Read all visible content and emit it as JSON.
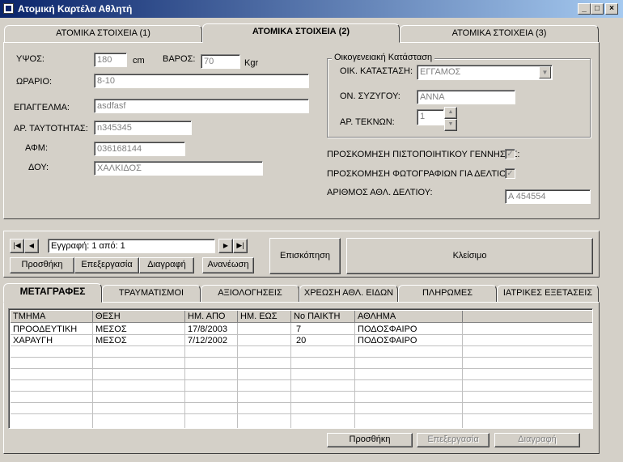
{
  "window": {
    "title": "Ατομική Καρτέλα Αθλητή"
  },
  "top_tabs": [
    "ΑΤΟΜΙΚΑ ΣΤΟΙΧΕΙΑ (1)",
    "ΑΤΟΜΙΚΑ ΣΤΟΙΧΕΙΑ (2)",
    "ΑΤΟΜΙΚΑ ΣΤΟΙΧΕΙΑ (3)"
  ],
  "form": {
    "height_label": "ΥΨΟΣ:",
    "height_value": "180",
    "height_unit": "cm",
    "weight_label": "ΒΑΡΟΣ:",
    "weight_value": "70",
    "weight_unit": "Kgr",
    "hours_label": "ΩΡΑΡΙΟ:",
    "hours_value": "8-10",
    "job_label": "ΕΠΑΓΓΕΛΜΑ:",
    "job_value": "asdfasf",
    "id_label": "ΑΡ. ΤΑΥΤΟΤΗΤΑΣ:",
    "id_value": "n345345",
    "afm_label": "ΑΦΜ:",
    "afm_value": "036168144",
    "doy_label": "ΔΟΥ:",
    "doy_value": "ΧΑΛΚΙΔΟΣ"
  },
  "family": {
    "group_title": "Οικογενειακή Κατάσταση",
    "status_label": "ΟΙΚ. ΚΑΤΑΣΤΑΣΗ:",
    "status_value": "ΕΓΓΑΜΟΣ",
    "spouse_label": "ΟΝ. ΣΥΖΥΓΟΥ:",
    "spouse_value": "ΑΝΝΑ",
    "children_label": "ΑΡ. ΤΕΚΝΩΝ:",
    "children_value": "1"
  },
  "docs": {
    "birth_cert_label": "ΠΡΟΣΚΟΜΗΣΗ ΠΙΣΤΟΠΟΙΗΤΙΚΟΥ ΓΕΝΝΗΣΗΣ:",
    "birth_cert_checked": true,
    "photos_label": "ΠΡΟΣΚΟΜΗΣΗ ΦΩΤΟΓΡΑΦΙΩΝ ΓΙΑ ΔΕΛΤΙΟ:",
    "photos_checked": true,
    "card_label": "ΑΡΙΘΜΟΣ ΑΘΛ. ΔΕΛΤΙΟΥ:",
    "card_value": "Α 454554"
  },
  "navigator": {
    "record_text": "Εγγραφή: 1 από: 1",
    "add": "Προσθήκη",
    "edit": "Επεξεργασία",
    "delete": "Διαγραφή",
    "refresh": "Ανανέωση",
    "preview": "Επισκόπηση",
    "close": "Κλείσιμο"
  },
  "bottom_tabs": [
    "ΜΕΤΑΓΡΑΦΕΣ",
    "ΤΡΑΥΜΑΤΙΣΜΟΙ",
    "ΑΞΙΟΛΟΓΗΣΕΙΣ",
    "ΧΡΕΩΣΗ ΑΘΛ. ΕΙΔΩΝ",
    "ΠΛΗΡΩΜΕΣ",
    "ΙΑΤΡΙΚΕΣ ΕΞΕΤΑΣΕΙΣ"
  ],
  "table": {
    "columns": [
      "ΤΜΗΜΑ",
      "ΘΕΣΗ",
      "ΗΜ. ΑΠΟ",
      "ΗΜ. ΕΩΣ",
      "Νο ΠΑΙΚΤΗ",
      "ΑΘΛΗΜΑ"
    ],
    "rows": [
      [
        "ΠΡΟΟΔΕΥΤΙΚΗ",
        "ΜΕΣΟΣ",
        "17/8/2003",
        "",
        "7",
        "ΠΟΔΟΣΦΑΙΡΟ"
      ],
      [
        "ΧΑΡΑΥΓΗ",
        "ΜΕΣΟΣ",
        "7/12/2002",
        "",
        "20",
        "ΠΟΔΟΣΦΑΙΡΟ"
      ]
    ]
  },
  "table_buttons": {
    "add": "Προσθήκη",
    "edit": "Επεξεργασία",
    "delete": "Διαγραφή"
  }
}
